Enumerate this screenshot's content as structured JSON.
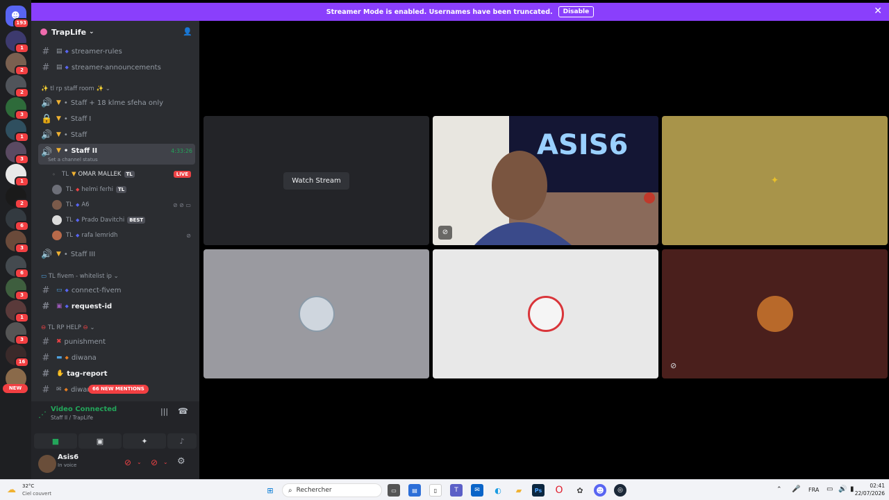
{
  "banner": {
    "text": "Streamer Mode is enabled. Usernames have been truncated.",
    "disable_label": "Disable",
    "close_glyph": "✕"
  },
  "guild": {
    "name": "TrapLife",
    "chevron": "⌄"
  },
  "server_badges": {
    "home": "193",
    "s1": "1",
    "s2": "2",
    "s3": "2",
    "s4": "3",
    "s5": "1",
    "s6": "3",
    "s7": "1",
    "s8": "2",
    "s9": "6",
    "s10": "3",
    "s11": "6",
    "s12": "3",
    "s13": "1",
    "s14": "3",
    "s15": "16",
    "new": "NEW"
  },
  "channels": {
    "streamer_rules": "streamer-rules",
    "streamer_announcements": "streamer-announcements",
    "cat_staff": "✨ tl rp staff room ✨",
    "staff_18": "Staff + 18 klme sfeha only",
    "staff_i": "Staff I",
    "staff": "Staff",
    "staff_ii": "Staff II",
    "staff_ii_timer": "4:33:26",
    "staff_ii_status": "Set a channel status",
    "staff_iii": "Staff III",
    "cat_fivem": "TL fivem - whitelist ip",
    "connect_fivem": "connect-fivem",
    "request_id": "request-id",
    "cat_help": "TL RP HELP",
    "punishment": "punishment",
    "diwana": "diwana",
    "tag_report": "tag-report",
    "diwan_partial": "diwan",
    "mentions": "66 NEW MENTIONS"
  },
  "voice_users": [
    {
      "prefix": "TL",
      "name": "OMAR MALLEK",
      "tag": "TL",
      "live": "LIVE"
    },
    {
      "prefix": "TL",
      "name": "helmi ferhi",
      "tag": "TL"
    },
    {
      "prefix": "TL",
      "name": "A6"
    },
    {
      "prefix": "TL",
      "name": "Prado Davitchi",
      "tag": "BEST"
    },
    {
      "prefix": "TL",
      "name": "rafa lemridh"
    }
  ],
  "voice": {
    "status": "Video Connected",
    "location": "Staff II / TrapLife"
  },
  "user": {
    "name": "Asis6",
    "status": "In voice"
  },
  "stage": {
    "watch_stream": "Watch Stream",
    "tile_logo_text": "ASIS6"
  },
  "taskbar": {
    "weather_temp": "32°C",
    "weather_desc": "Ciel couvert",
    "search": "Rechercher",
    "lang": "FRA",
    "time": "02:41",
    "date": "22/07/2026"
  },
  "colors": {
    "accent": "#8a3ffc",
    "live": "#ed4245",
    "connected": "#23a55a"
  }
}
